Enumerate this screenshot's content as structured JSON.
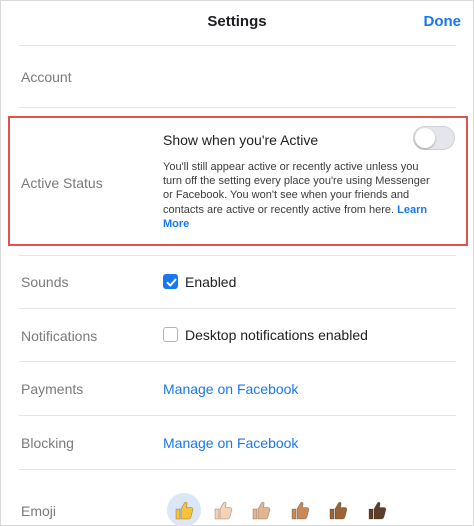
{
  "header": {
    "title": "Settings",
    "done_label": "Done"
  },
  "account": {
    "label": "Account"
  },
  "active_status": {
    "label": "Active Status",
    "title": "Show when you're Active",
    "toggle_on": false,
    "description": "You'll still appear active or recently active unless you turn off the setting every place you're using Messenger or Facebook. You won't see when your friends and contacts are active or recently active from here.",
    "learn_more": "Learn More"
  },
  "sounds": {
    "label": "Sounds",
    "option": "Enabled",
    "checked": true
  },
  "notifications": {
    "label": "Notifications",
    "option": "Desktop notifications enabled",
    "checked": false
  },
  "payments": {
    "label": "Payments",
    "link": "Manage on Facebook"
  },
  "blocking": {
    "label": "Blocking",
    "link": "Manage on Facebook"
  },
  "emoji": {
    "label": "Emoji",
    "skin_tones": [
      {
        "icon": "thumbs-up-yellow-icon",
        "color": "#f7c33d",
        "selected": true
      },
      {
        "icon": "thumbs-up-light-icon",
        "color": "#f6d2b8",
        "selected": false
      },
      {
        "icon": "thumbs-up-medium-light-icon",
        "color": "#e2b48f",
        "selected": false
      },
      {
        "icon": "thumbs-up-medium-icon",
        "color": "#c78a57",
        "selected": false
      },
      {
        "icon": "thumbs-up-medium-dark-icon",
        "color": "#9b6336",
        "selected": false
      },
      {
        "icon": "thumbs-up-dark-icon",
        "color": "#5e3e2a",
        "selected": false
      }
    ]
  },
  "colors": {
    "accent": "#1877f2",
    "highlight_border": "#e05252"
  }
}
